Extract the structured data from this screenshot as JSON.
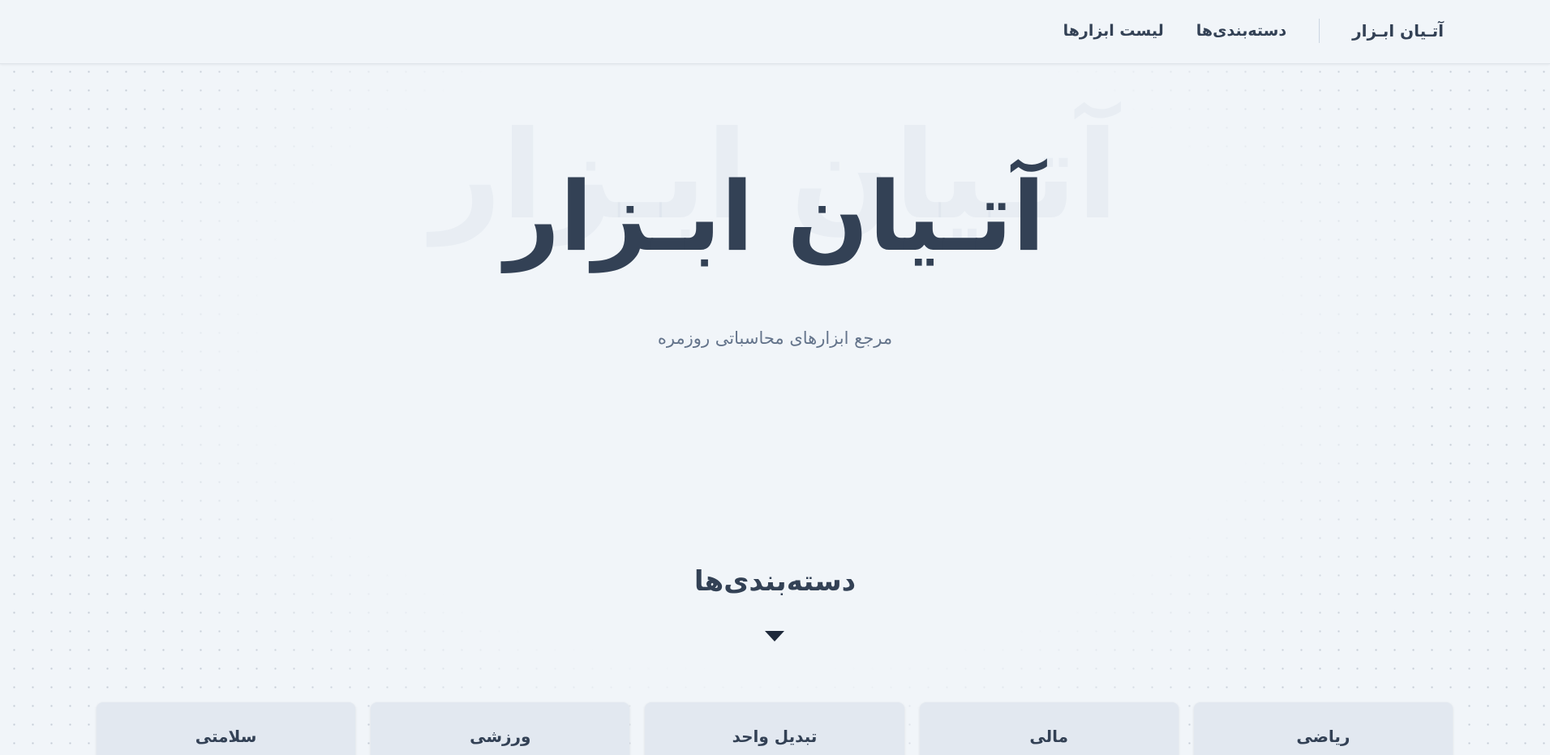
{
  "header": {
    "brand": "آتـیان ابـزار",
    "nav": [
      "دسته‌بندی‌ها",
      "لیست ابزارها"
    ]
  },
  "hero": {
    "title": "آتـیان ابـزار",
    "subtitle": "مرجع ابزارهای محاسباتی روزمره"
  },
  "categories": {
    "heading": "دسته‌بندی‌ها",
    "items": [
      "ریاضی",
      "مالی",
      "تبدیل واحد",
      "ورزشی",
      "سلامتی"
    ]
  },
  "colors": {
    "text": "#334155",
    "muted": "#64748b",
    "background": "#f1f5f9",
    "card": "#e2e8f0"
  }
}
